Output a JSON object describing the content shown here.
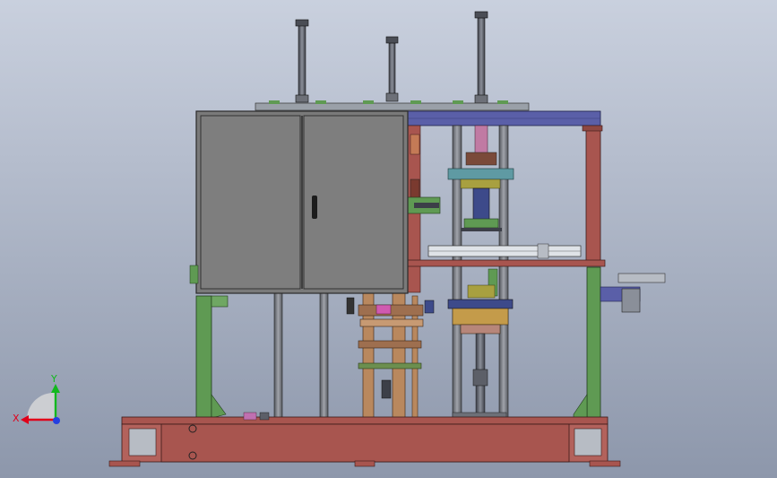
{
  "viewport": {
    "background_top": "#c9d0de",
    "background_bottom": "#8d97ab"
  },
  "triad": {
    "x_label": "X",
    "y_label": "Y",
    "x_color": "#e0001a",
    "y_color": "#12b81e",
    "z_color": "#2540e0"
  },
  "colors": {
    "cabinet": "#7a7a7a",
    "cabinet_edge": "#2a2a2a",
    "frame_red": "#a8554f",
    "frame_green": "#5f9a53",
    "frame_blue": "#5a5fa8",
    "column_gray": "#5c5f68",
    "mechanism_tan": "#b9885e"
  }
}
